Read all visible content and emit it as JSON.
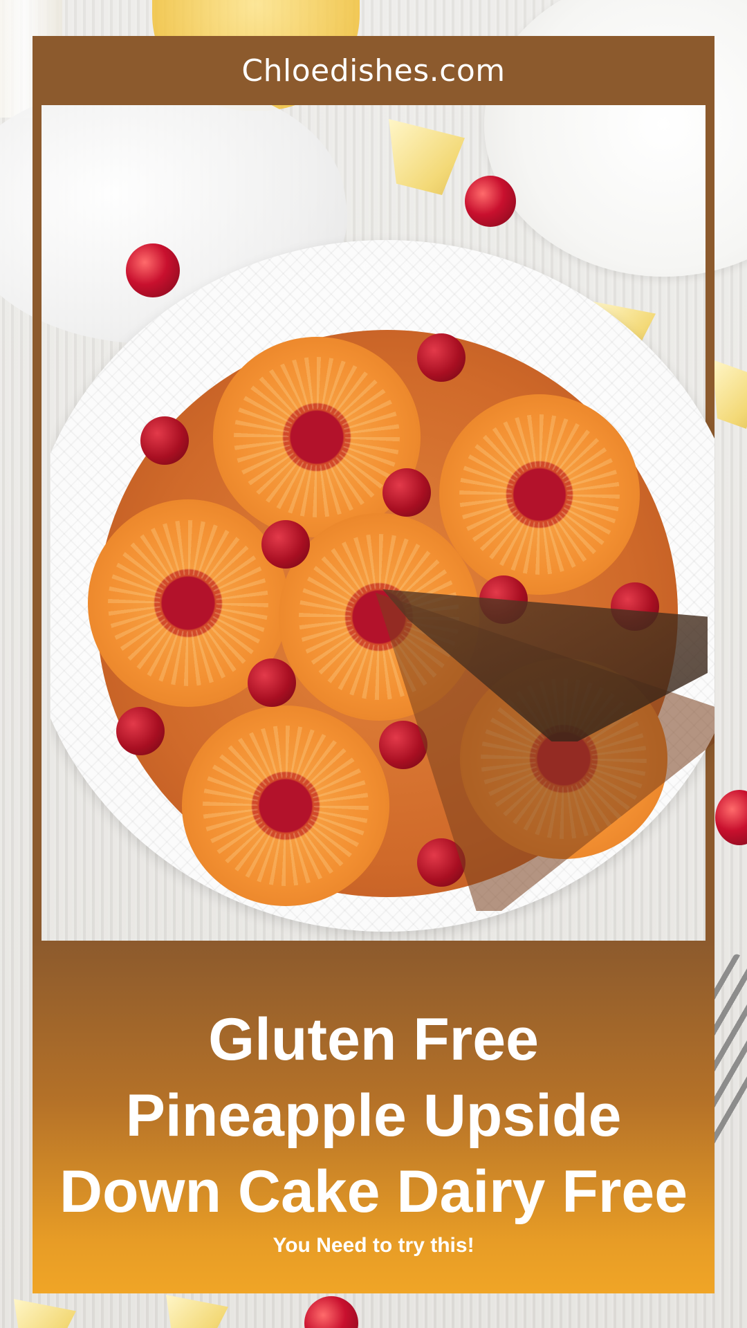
{
  "site": {
    "name": "Chloedishes.com"
  },
  "title": {
    "lines": [
      "Gluten Free",
      "Pineapple Upside",
      "Down Cake Dairy Free"
    ]
  },
  "tagline": "You Need to try this!",
  "colors": {
    "frame_brown": "#8c5a2d",
    "gradient_end_orange": "#f0a526",
    "text": "#ffffff"
  }
}
